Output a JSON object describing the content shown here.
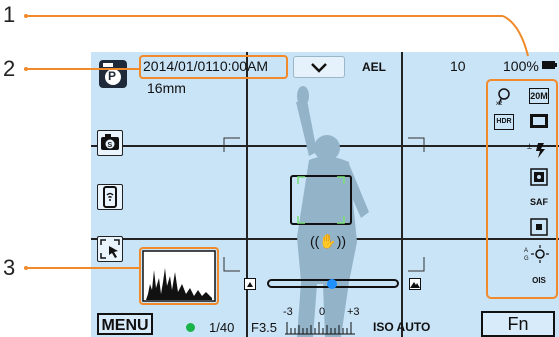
{
  "callouts": [
    "1",
    "2",
    "3"
  ],
  "status": {
    "datetime": "2014/01/0110:00AM",
    "focal_length": "16mm",
    "ael": "AEL",
    "shots_remaining": "10",
    "battery": "100%"
  },
  "bottom": {
    "shutter": "1/40",
    "aperture": "F3.5",
    "ev_scale": [
      "-3",
      "0",
      "+3"
    ],
    "iso": "ISO AUTO",
    "menu_label": "MENU",
    "fn_label": "Fn"
  },
  "mode_letter": "P",
  "right_icons": [
    "face-detection-icon",
    "image-size-icon",
    "hdr-icon",
    "quality-icon",
    "flash-icon",
    "metering-icon",
    "af-mode-icon",
    "af-area-icon",
    "white-balance-icon",
    "ois-icon"
  ],
  "right_icon_labels": {
    "image_size": "20M",
    "hdr": "HDR",
    "af_mode": "SAF",
    "ois": "OIS"
  },
  "colors": {
    "screen": "#c9e3f7",
    "callout_line": "#f08a2a",
    "af_bracket": "#7be07b",
    "slider_dot": "#1e90ff",
    "status_dot": "#19b34a"
  }
}
